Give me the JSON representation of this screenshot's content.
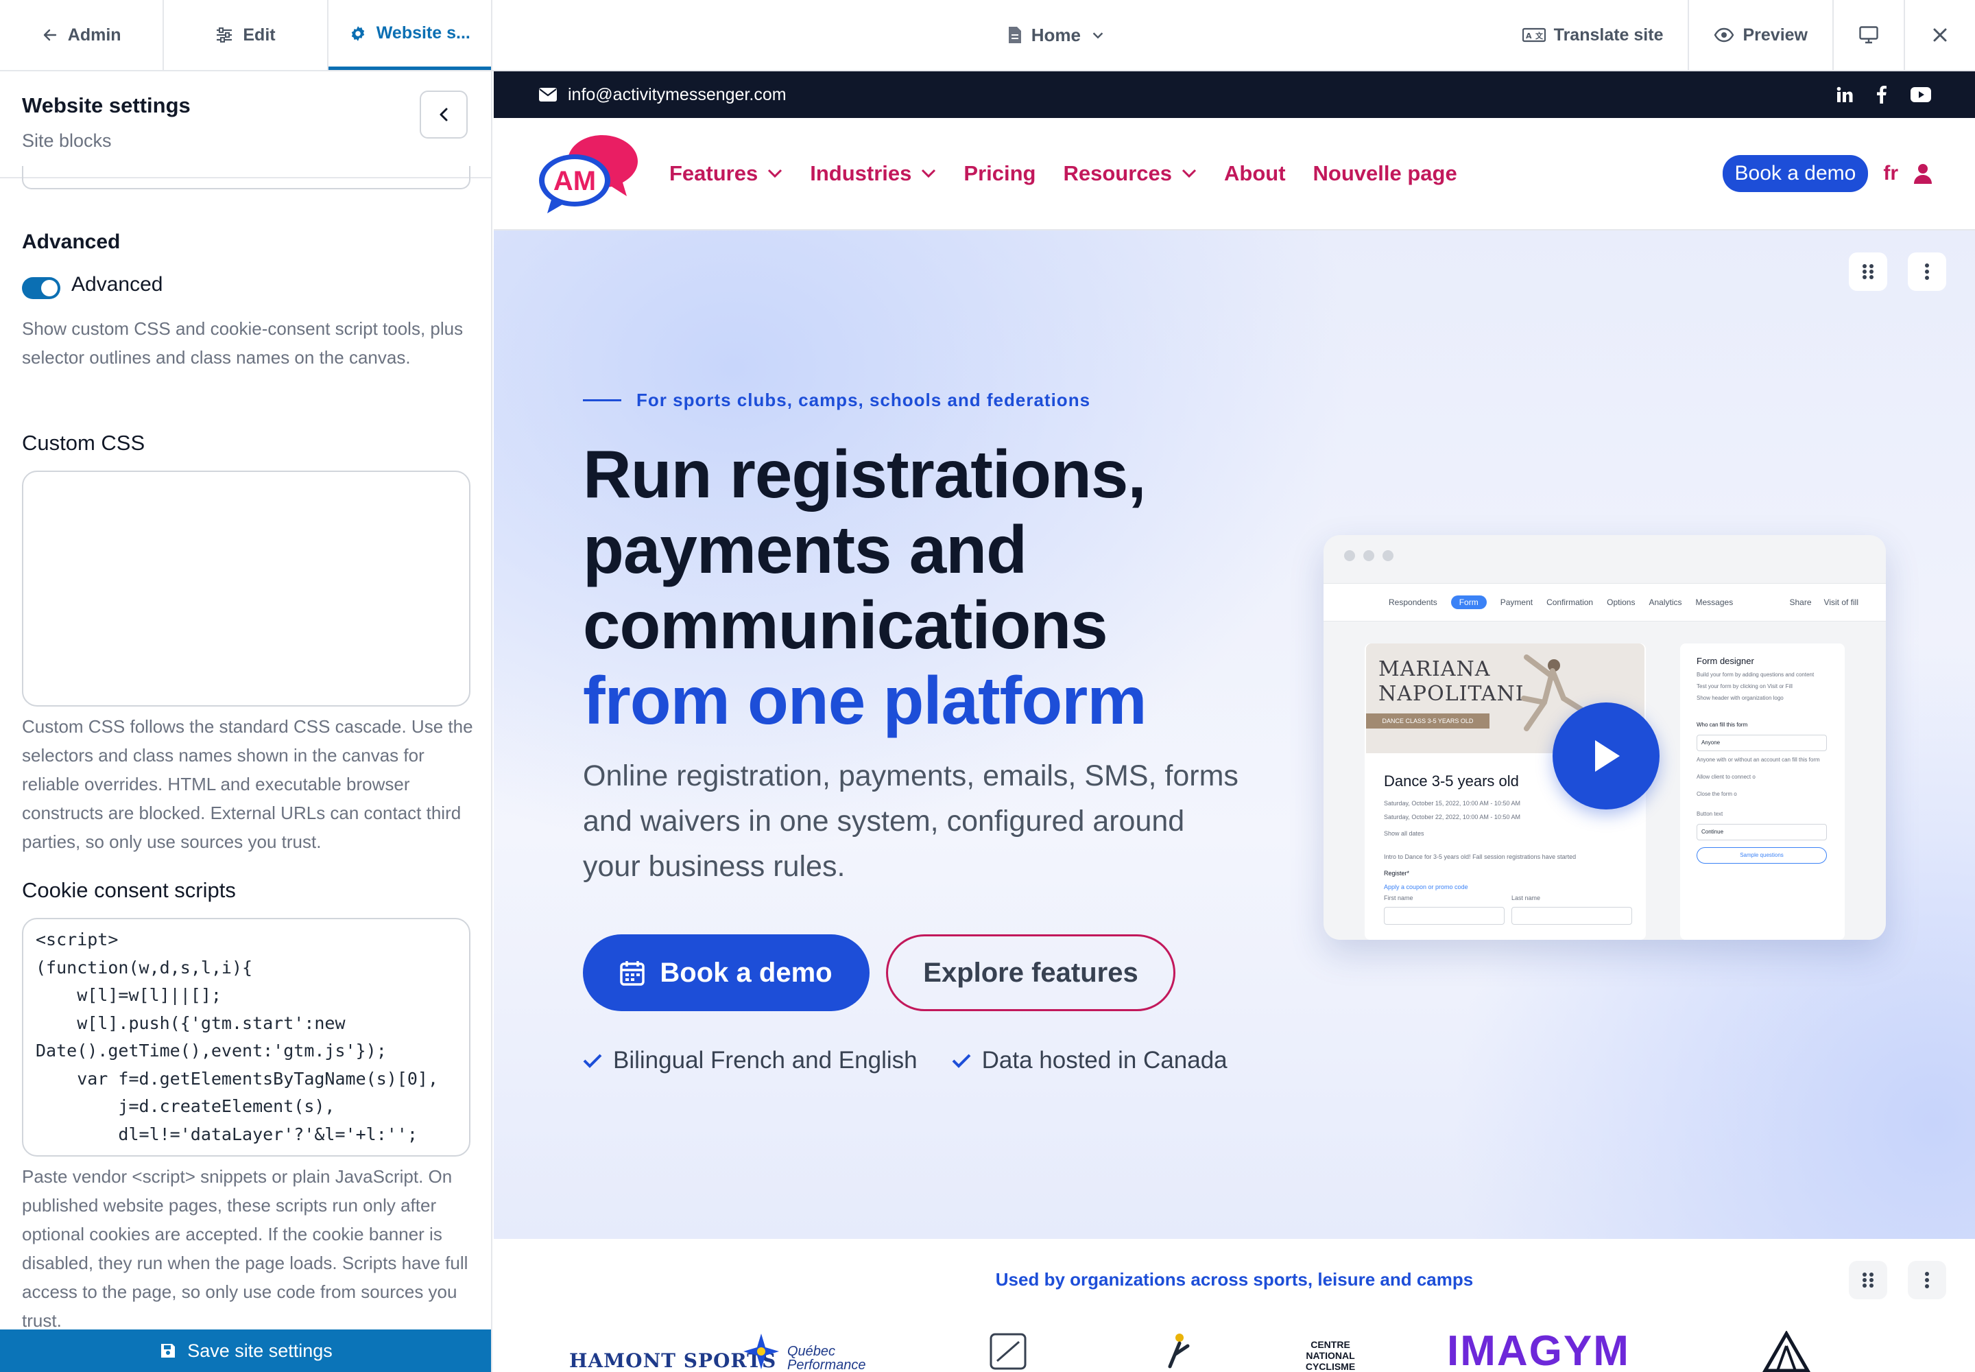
{
  "topbar": {
    "tabs": [
      {
        "label": "Admin",
        "icon": "arrow-left-icon"
      },
      {
        "label": "Edit",
        "icon": "sliders-icon"
      },
      {
        "label": "Website s...",
        "icon": "gear-icon"
      }
    ],
    "page_selector": "Home",
    "translate_label": "Translate site",
    "preview_label": "Preview"
  },
  "panel": {
    "title": "Website settings",
    "subtitle": "Site blocks",
    "advanced_heading": "Advanced",
    "advanced_toggle_label": "Advanced",
    "advanced_toggle_on": true,
    "advanced_help": "Show custom CSS and cookie-consent script tools, plus selector outlines and class names on the canvas.",
    "custom_css_label": "Custom CSS",
    "custom_css_value": "",
    "custom_css_help": "Custom CSS follows the standard CSS cascade. Use the selectors and class names shown in the canvas for reliable overrides. HTML and executable browser constructs are blocked. External URLs can contact third parties, so only use sources you trust.",
    "cookie_label": "Cookie consent scripts",
    "cookie_value": "<script>\n(function(w,d,s,l,i){\n    w[l]=w[l]||[];\n    w[l].push({'gtm.start':new\nDate().getTime(),event:'gtm.js'});\n    var f=d.getElementsByTagName(s)[0],\n        j=d.createElement(s),\n        dl=l!='dataLayer'?'&l='+l:'';",
    "cookie_help": "Paste vendor <script> snippets or plain JavaScript. On published website pages, these scripts run only after optional cookies are accepted. If the cookie banner is disabled, they run when the page loads. Scripts have full access to the page, so only use code from sources you trust.",
    "save_label": "Save site settings"
  },
  "site": {
    "email": "info@activitymessenger.com",
    "logo_text": "AM",
    "nav": [
      {
        "label": "Features",
        "dropdown": true
      },
      {
        "label": "Industries",
        "dropdown": true
      },
      {
        "label": "Pricing",
        "dropdown": false
      },
      {
        "label": "Resources",
        "dropdown": true
      },
      {
        "label": "About",
        "dropdown": false
      },
      {
        "label": "Nouvelle page",
        "dropdown": false
      }
    ],
    "book_demo": "Book a demo",
    "lang": "fr",
    "hero": {
      "eyebrow": "For sports clubs, camps, schools and federations",
      "h1_line1": "Run registrations,",
      "h1_line2": "payments and",
      "h1_line3": "communications",
      "h1_accent": "from one platform",
      "lead": "Online registration, payments, emails, SMS, forms and waivers in one system, configured around your business rules.",
      "cta_primary": "Book a demo",
      "cta_secondary": "Explore features",
      "checks": [
        "Bilingual French and English",
        "Data hosted in Canada"
      ]
    },
    "mock": {
      "tabs": [
        "Respondents",
        "Form",
        "Payment",
        "Confirmation",
        "Options",
        "Analytics",
        "Messages"
      ],
      "active_tab": "Form",
      "share": "Share",
      "visit": "Visit of fill",
      "poster_name_1": "MARIANA",
      "poster_name_2": "NAPOLITANI",
      "poster_tag": "DANCE CLASS 3-5 YEARS OLD",
      "event_title": "Dance 3-5 years old",
      "date1": "Saturday, October 15, 2022, 10:00 AM - 10:50 AM",
      "date2": "Saturday, October 22, 2022, 10:00 AM - 10:50 AM",
      "show_all": "Show all dates",
      "intro": "Intro to Dance for 3-5 years old! Fall session registrations have started",
      "register": "Register*",
      "coupon": "Apply a coupon or promo code",
      "first_name": "First name",
      "last_name": "Last name",
      "designer_title": "Form designer",
      "designer_b1": "Build your form by adding questions and content",
      "designer_b2": "Test your form by clicking on Visit or Fill",
      "designer_opt": "Show header with organization logo",
      "who_fill": "Who can fill this form",
      "who_value": "Anyone",
      "who_help": "Anyone with or without an account can fill this form",
      "allow_client": "Allow client to connect o",
      "close_form": "Close the form o",
      "button_text": "Button text",
      "button_value": "Continue",
      "sample": "Sample questions"
    },
    "strip_caption": "Used by organizations across sports, leisure and camps",
    "logos": [
      "HAMONT SPORTS",
      "Québec Performance",
      "CENTRE NATIONAL CYCLISME",
      "IMAGYM"
    ]
  },
  "colors": {
    "brand_blue": "#1d4ed8",
    "brand_pink": "#c2185b",
    "editor_blue": "#0b6fb3"
  }
}
